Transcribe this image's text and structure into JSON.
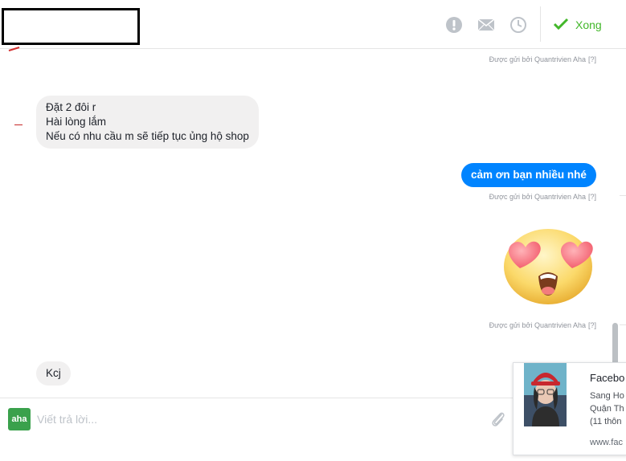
{
  "header": {
    "done_label": "Xong",
    "icons": [
      "report-icon",
      "mail-icon",
      "clock-icon",
      "check-icon"
    ]
  },
  "messages": {
    "sent_by_1": "Được gửi bởi Quantrivien Aha",
    "sent_by_2": "Được gửi bởi Quantrivien Aha",
    "sent_by_3": "Được gửi bởi Quantrivien Aha",
    "help_marker": "[?]",
    "incoming_1_lines": [
      "Đặt 2 đôi r",
      "Hài lòng lắm",
      "Nếu có nhu cầu m sẽ tiếp tục ủng hộ shop"
    ],
    "outgoing_1": "cảm ơn bạn nhiều nhé",
    "sticker": "heart-eyes-emoji-sticker",
    "incoming_2": "Kcj"
  },
  "composer": {
    "avatar_text": "aha",
    "placeholder": "Viết trả lời...",
    "value": ""
  },
  "link_card": {
    "title": "Facebo",
    "lines": [
      "Sang Ho",
      "Quận Th",
      "(11 thôn"
    ],
    "domain": "www.fac"
  },
  "colors": {
    "accent_blue": "#0084ff",
    "done_green": "#42b72a",
    "incoming_bubble": "#f1f0f0"
  }
}
